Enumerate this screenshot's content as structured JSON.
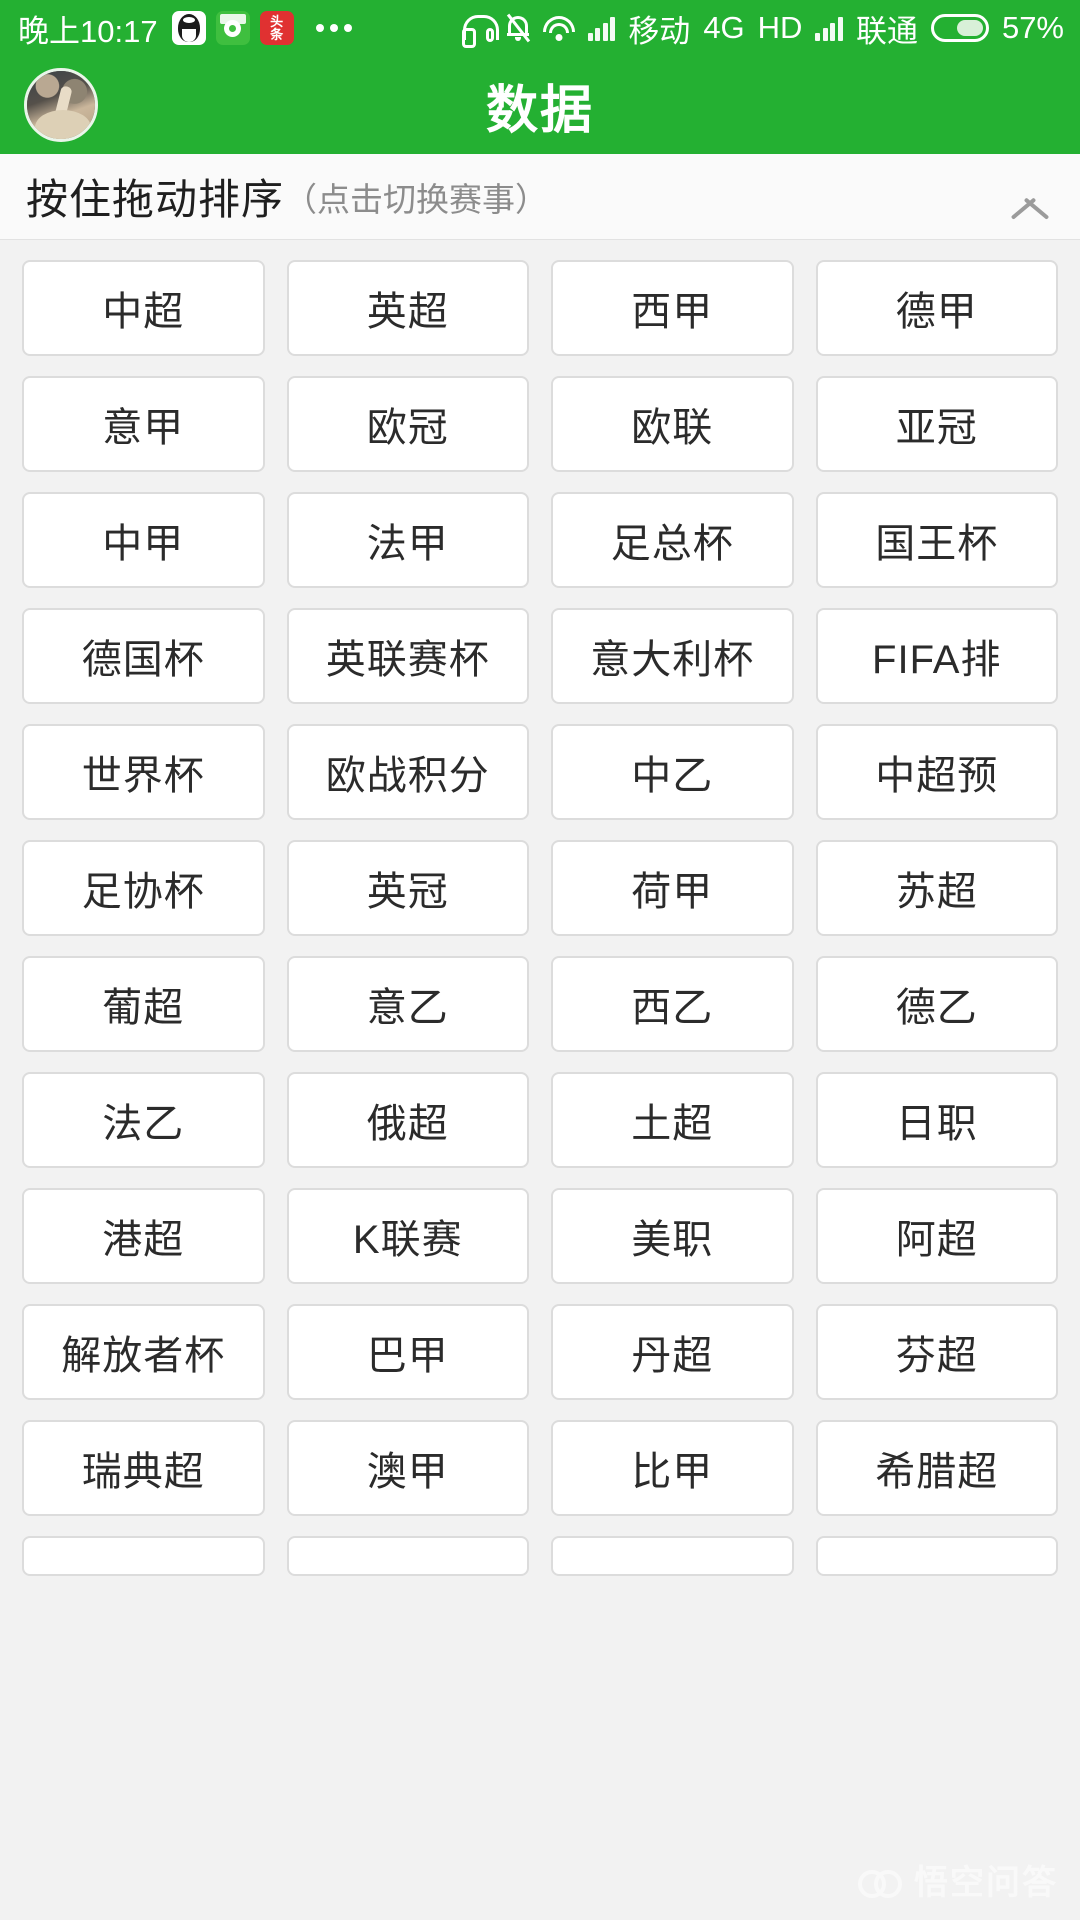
{
  "status_bar": {
    "time": "晚上10:17",
    "app_icons": [
      {
        "name": "qq-icon",
        "label": "QQ"
      },
      {
        "name": "score-app-icon",
        "label": "球"
      },
      {
        "name": "toutiao-icon",
        "label": "头条"
      }
    ],
    "overflow": "...",
    "icons": [
      "headset-icon",
      "bell-muted-icon",
      "wifi-icon",
      "signal-icon"
    ],
    "carrier_1": "移动",
    "network": "4G",
    "hd": "HD",
    "carrier_2": "联通",
    "battery_percent": "57%"
  },
  "title_bar": {
    "title": "数据",
    "avatar_name": "user-avatar"
  },
  "section": {
    "main_label": "按住拖动排序",
    "sub_label": "（点击切换赛事）",
    "collapse_icon": "chevron-up-icon"
  },
  "leagues": [
    "中超",
    "英超",
    "西甲",
    "德甲",
    "意甲",
    "欧冠",
    "欧联",
    "亚冠",
    "中甲",
    "法甲",
    "足总杯",
    "国王杯",
    "德国杯",
    "英联赛杯",
    "意大利杯",
    "FIFA排",
    "世界杯",
    "欧战积分",
    "中乙",
    "中超预",
    "足协杯",
    "英冠",
    "荷甲",
    "苏超",
    "葡超",
    "意乙",
    "西乙",
    "德乙",
    "法乙",
    "俄超",
    "土超",
    "日职",
    "港超",
    "K联赛",
    "美职",
    "阿超",
    "解放者杯",
    "巴甲",
    "丹超",
    "芬超",
    "瑞典超",
    "澳甲",
    "比甲",
    "希腊超"
  ],
  "partial_row_count": 4,
  "watermark": {
    "text": "悟空问答"
  },
  "colors": {
    "brand_green": "#24b032",
    "page_background": "#f2f2f2",
    "cell_background": "#ffffff",
    "cell_border": "#dcdcdc",
    "text_primary": "#2b2b2b",
    "text_secondary": "#8c8c8c"
  }
}
